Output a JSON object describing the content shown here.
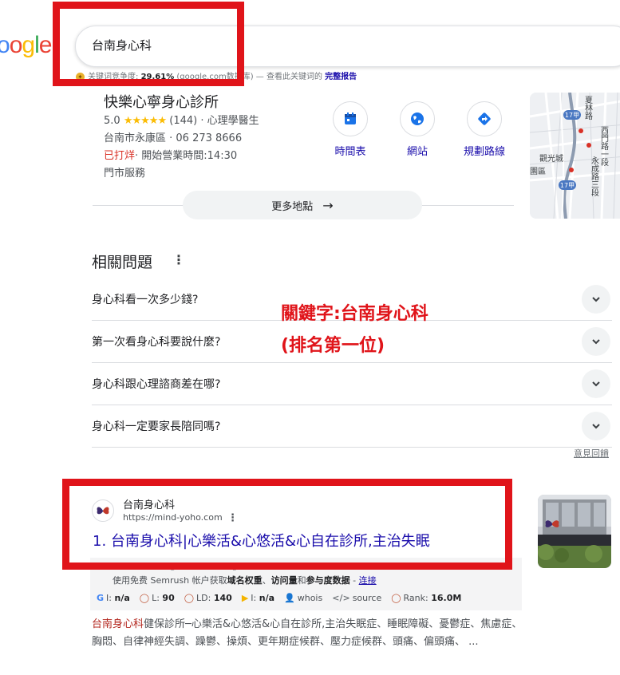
{
  "logo": {
    "text": "ogle"
  },
  "search": {
    "query": "台南身心科"
  },
  "keyword_stats": {
    "label": "关键词竞争度:",
    "percent": "29.61%",
    "source": "(google.com数据库)",
    "check_text": "— 查看此关键词的",
    "report_link": "完整报告"
  },
  "business": {
    "name": "快樂心寧身心診所",
    "rating": "5.0",
    "stars": "★★★★★",
    "reviews": "(144)",
    "category": "· 心理學醫生",
    "address": "台南市永康區 · 06 273 8666",
    "status": "已打烊",
    "hours": "· 開始營業時間:14:30",
    "service": "門市服務"
  },
  "actions": [
    {
      "label": "時間表",
      "icon": "calendar-icon"
    },
    {
      "label": "網站",
      "icon": "globe-icon"
    },
    {
      "label": "規劃路線",
      "icon": "directions-icon"
    }
  ],
  "map": {
    "labels": [
      "夏林路",
      "西門路一段",
      "觀光城",
      "永成路三段",
      "園區",
      "17甲",
      "17甲"
    ]
  },
  "more_places": {
    "label": "更多地點"
  },
  "paa": {
    "title": "相關問題",
    "questions": [
      "身心科看一次多少錢?",
      "第一次看身心科要說什麼?",
      "身心科跟心理諮商差在哪?",
      "身心科一定要家長陪同嗎?"
    ],
    "feedback": "意見回饋"
  },
  "annotation": {
    "line1": "關鍵字:台南身心科",
    "line2": "(排名第一位)"
  },
  "result": {
    "site_name": "台南身心科",
    "url": "https://mind-yoho.com",
    "title": "1. 台南身心科|心樂活&心悠活&心自在診所,主治失眠",
    "snippet_highlight": "台南身心科",
    "snippet_rest": "健保診所─心樂活&心悠活&心自在診所,主治失眠症、睡眠障礙、憂鬱症、焦慮症、胸悶、自律神經失調、躁鬱、操煩、更年期症候群、壓力症候群、頭痛、偏頭痛、 ..."
  },
  "semrush": {
    "top": "AS: 0   Visits: 0   Pages/Visit: 0   Avg. Visit: 0   Bounce rate: 0",
    "promo_pre": "使用免费 Semrush 帐户获取",
    "promo_b1": "域名权重",
    "promo_sep": "、",
    "promo_b2": "访问量",
    "promo_and": "和",
    "promo_b3": "参与度数据",
    "promo_dash": " - ",
    "promo_link": "连接",
    "metrics": {
      "i_label": "I:",
      "i_val": "n/a",
      "l_label": "L:",
      "l_val": "90",
      "ld_label": "LD:",
      "ld_val": "140",
      "bi_label": "I:",
      "bi_val": "n/a",
      "whois": "whois",
      "source": "source",
      "rank_label": "Rank:",
      "rank_val": "16.0M"
    }
  },
  "colors": {
    "link": "#1a0dab",
    "annotation_red": "#e0141a",
    "star": "#fbbc04"
  }
}
